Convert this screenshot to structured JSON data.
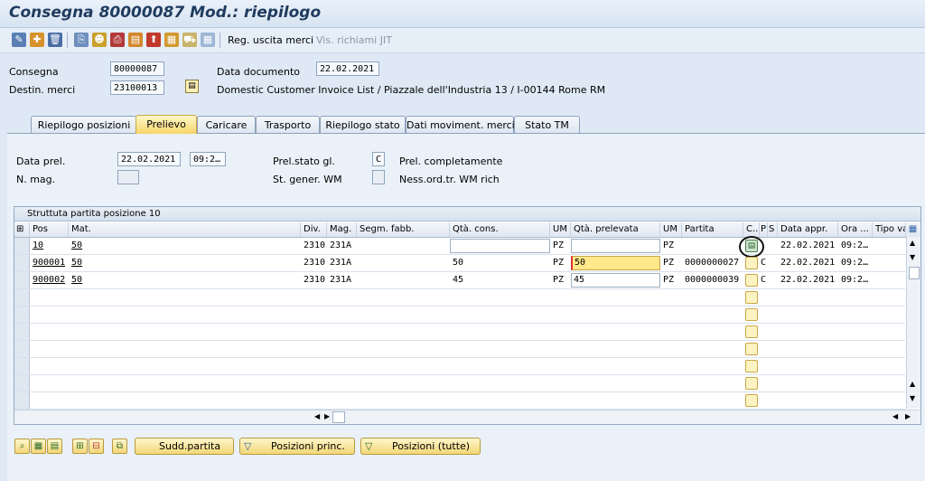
{
  "window": {
    "title": "Consegna 80000087 Mod.: riepilogo"
  },
  "toolbar": {
    "goods_issue_label": "Reg. uscita merci",
    "jit_calls_label": "Vis. richiami JIT"
  },
  "header": {
    "delivery_label": "Consegna",
    "delivery_value": "80000087",
    "doc_date_label": "Data documento",
    "doc_date_value": "22.02.2021",
    "ship_to_label": "Destin. merci",
    "ship_to_value": "23100013",
    "ship_to_desc": "Domestic Customer Invoice List / Piazzale dell'Industria 13 / I-00144 Rome RM"
  },
  "tabs": [
    {
      "label": "Riepilogo posizioni"
    },
    {
      "label": "Prelievo",
      "active": true
    },
    {
      "label": "Caricare"
    },
    {
      "label": "Trasporto"
    },
    {
      "label": "Riepilogo stato"
    },
    {
      "label": "Dati moviment. merci"
    },
    {
      "label": "Stato TM"
    }
  ],
  "picking": {
    "pick_date_label": "Data prel.",
    "pick_date_value": "22.02.2021",
    "pick_time_value": "09:2…",
    "overall_status_label": "Prel.stato gl.",
    "overall_status_value": "C",
    "overall_status_text": "Prel. completamente",
    "warehouse_label": "N. mag.",
    "warehouse_value": "",
    "wm_status_label": "St. gener. WM",
    "wm_status_value": "",
    "wm_status_text": "Ness.ord.tr. WM rich"
  },
  "grid": {
    "title": "Struttuta partita posizione 10",
    "columns": [
      "Pos",
      "Mat.",
      "Div.",
      "Mag.",
      "Segm. fabb.",
      "Qtà. cons.",
      "UM",
      "Qtà. prelevata",
      "UM",
      "Partita",
      "C...",
      "P",
      "S",
      "Data appr.",
      "Ora ...",
      "Tipo va"
    ],
    "rows": [
      {
        "pos": "10",
        "mat": "50",
        "div": "2310",
        "mag": "231A",
        "segm": "",
        "qty": "",
        "um": "PZ",
        "picked": "",
        "um2": "PZ",
        "batch": "",
        "c": "",
        "p": "",
        "s": "",
        "date": "22.02.2021",
        "time": "09:2…"
      },
      {
        "pos": "900001",
        "mat": "50",
        "div": "2310",
        "mag": "231A",
        "segm": "",
        "qty": "50",
        "um": "PZ",
        "picked": "50",
        "um2": "PZ",
        "batch": "0000000027",
        "c": "",
        "p": "C",
        "s": "",
        "date": "22.02.2021",
        "time": "09:2…"
      },
      {
        "pos": "900002",
        "mat": "50",
        "div": "2310",
        "mag": "231A",
        "segm": "",
        "qty": "45",
        "um": "PZ",
        "picked": "45",
        "um2": "PZ",
        "batch": "0000000039",
        "c": "",
        "p": "C",
        "s": "",
        "date": "22.02.2021",
        "time": "09:2…"
      }
    ]
  },
  "buttons": {
    "split_batch": "Sudd.partita",
    "main_items": "Posizioni princ.",
    "all_items": "Posizioni (tutte)"
  },
  "colors": {
    "accent": "#f3d777",
    "title": "#1f3b5e",
    "tab_active": "#f6d66a"
  }
}
